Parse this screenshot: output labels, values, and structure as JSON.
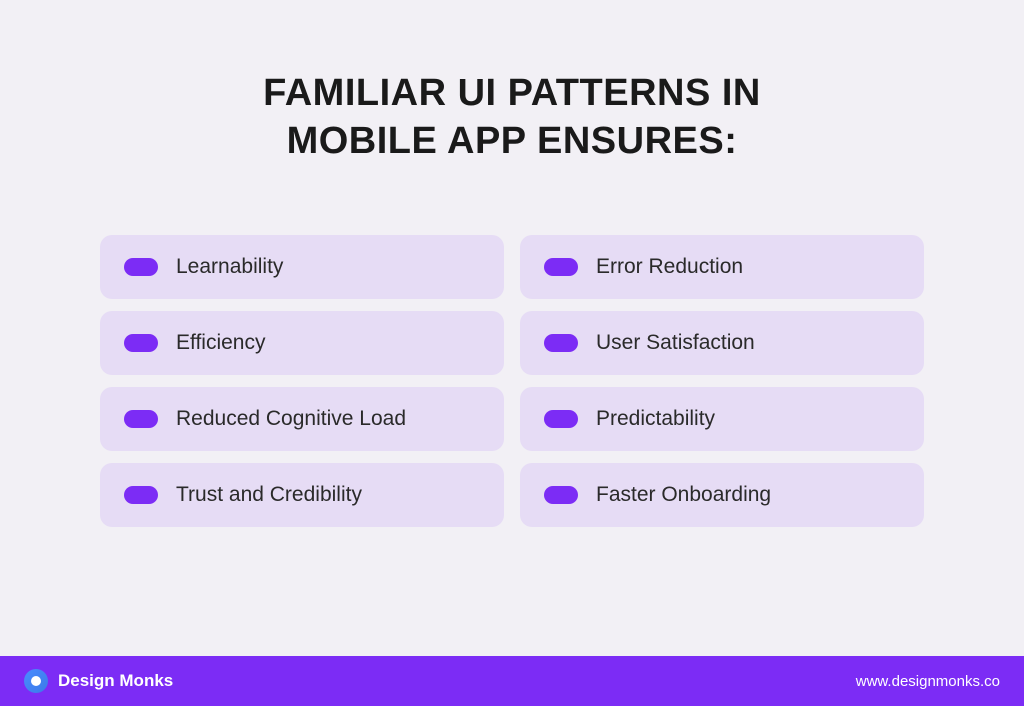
{
  "title_line1": "FAMILIAR UI PATTERNS IN",
  "title_line2": "MOBILE APP ENSURES:",
  "benefits": {
    "left": [
      "Learnability",
      "Efficiency",
      "Reduced Cognitive Load",
      "Trust and Credibility"
    ],
    "right": [
      "Error Reduction",
      "User Satisfaction",
      "Predictability",
      "Faster Onboarding"
    ]
  },
  "brand": {
    "name": "Design Monks"
  },
  "footer": {
    "url": "www.designmonks.co"
  },
  "colors": {
    "background": "#f2f0f5",
    "card_background": "#e6dcf5",
    "accent": "#7c2cf5",
    "text_dark": "#1a1a1a",
    "text_body": "#2a2a2a"
  }
}
